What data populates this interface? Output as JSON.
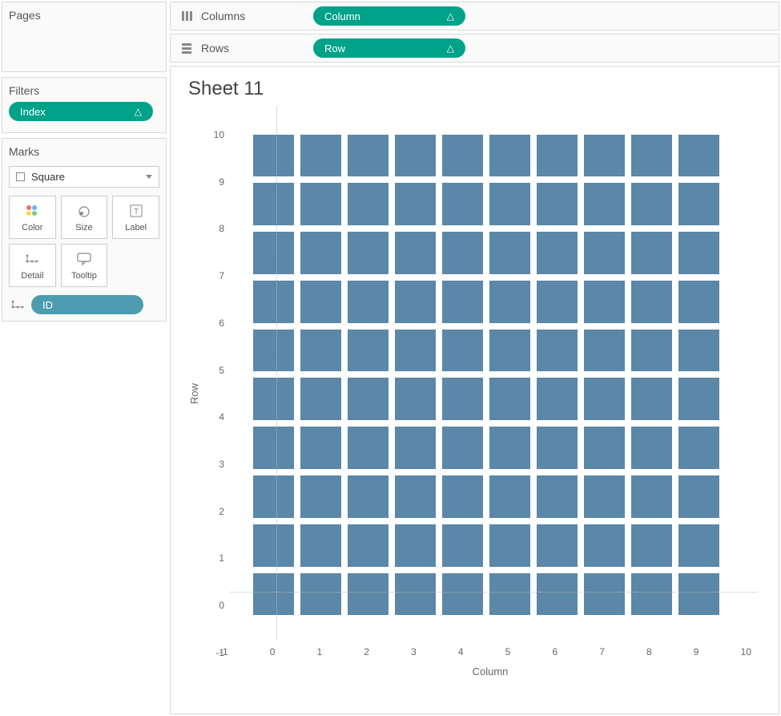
{
  "panels": {
    "pages_label": "Pages",
    "filters_label": "Filters",
    "marks_label": "Marks"
  },
  "filters": {
    "pill_label": "Index"
  },
  "shelves": {
    "columns_label": "Columns",
    "columns_pill": "Column",
    "rows_label": "Rows",
    "rows_pill": "Row"
  },
  "marks": {
    "type_selected": "Square",
    "cards": {
      "color": "Color",
      "size": "Size",
      "label": "Label",
      "detail": "Detail",
      "tooltip": "Tooltip"
    },
    "detail_pill": "ID"
  },
  "sheet": {
    "title": "Sheet 11"
  },
  "chart_data": {
    "type": "scatter",
    "title": "Sheet 11",
    "xlabel": "Column",
    "ylabel": "Row",
    "xlim": [
      -1,
      10
    ],
    "ylim": [
      -1,
      10
    ],
    "x_ticks": [
      "-1",
      "0",
      "1",
      "2",
      "3",
      "4",
      "5",
      "6",
      "7",
      "8",
      "9",
      "10"
    ],
    "y_ticks": [
      "10",
      "9",
      "8",
      "7",
      "6",
      "5",
      "4",
      "3",
      "2",
      "1",
      "0",
      "-1"
    ],
    "mark_color": "#5b87a8",
    "grid_rows": 10,
    "grid_cols": 10,
    "x_values": [
      0,
      1,
      2,
      3,
      4,
      5,
      6,
      7,
      8,
      9
    ],
    "y_values": [
      0,
      1,
      2,
      3,
      4,
      5,
      6,
      7,
      8,
      9
    ],
    "description": "10x10 uniform grid of square marks at integer coordinates (0..9, 0..9)"
  }
}
